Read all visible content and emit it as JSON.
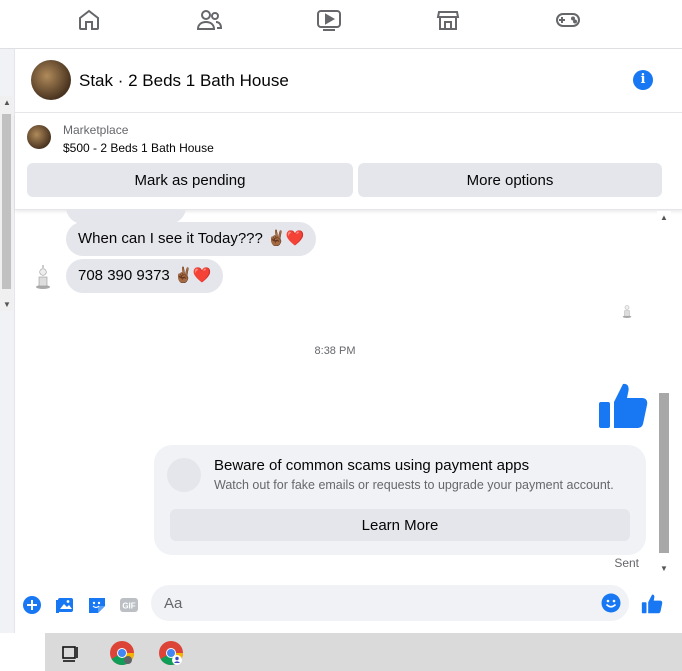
{
  "topnav": {
    "items": [
      {
        "icon": "home-icon"
      },
      {
        "icon": "friends-icon"
      },
      {
        "icon": "watch-icon"
      },
      {
        "icon": "marketplace-icon"
      },
      {
        "icon": "gaming-icon"
      }
    ]
  },
  "chat": {
    "title": "Stak · 2 Beds 1 Bath House",
    "info_icon": "info-icon",
    "marketplace": {
      "label": "Marketplace",
      "item": "$500 - 2 Beds 1 Bath House",
      "mark_pending": "Mark as pending",
      "more_options": "More options"
    },
    "messages": [
      {
        "text": "When can I see it Today???",
        "emoji": "✌🏾❤️"
      },
      {
        "text": "708 390 9373",
        "emoji": "✌🏾❤️"
      }
    ],
    "timestamp": "8:38 PM",
    "scam_notice": {
      "title": "Beware of common scams using payment apps",
      "subtitle": "Watch out for fake emails or requests to upgrade your payment account.",
      "button": "Learn More"
    },
    "status": "Sent",
    "composer": {
      "placeholder": "Aa",
      "icons": [
        "plus-icon",
        "photo-icon",
        "sticker-icon",
        "gif-icon",
        "emoji-icon",
        "like-icon"
      ]
    }
  },
  "taskbar": {
    "items": [
      "task-view-icon",
      "chrome-icon",
      "chrome-profile-icon"
    ]
  },
  "colors": {
    "accent": "#1877f2",
    "bubble": "#e4e6eb",
    "heart": "#e41e3f"
  }
}
